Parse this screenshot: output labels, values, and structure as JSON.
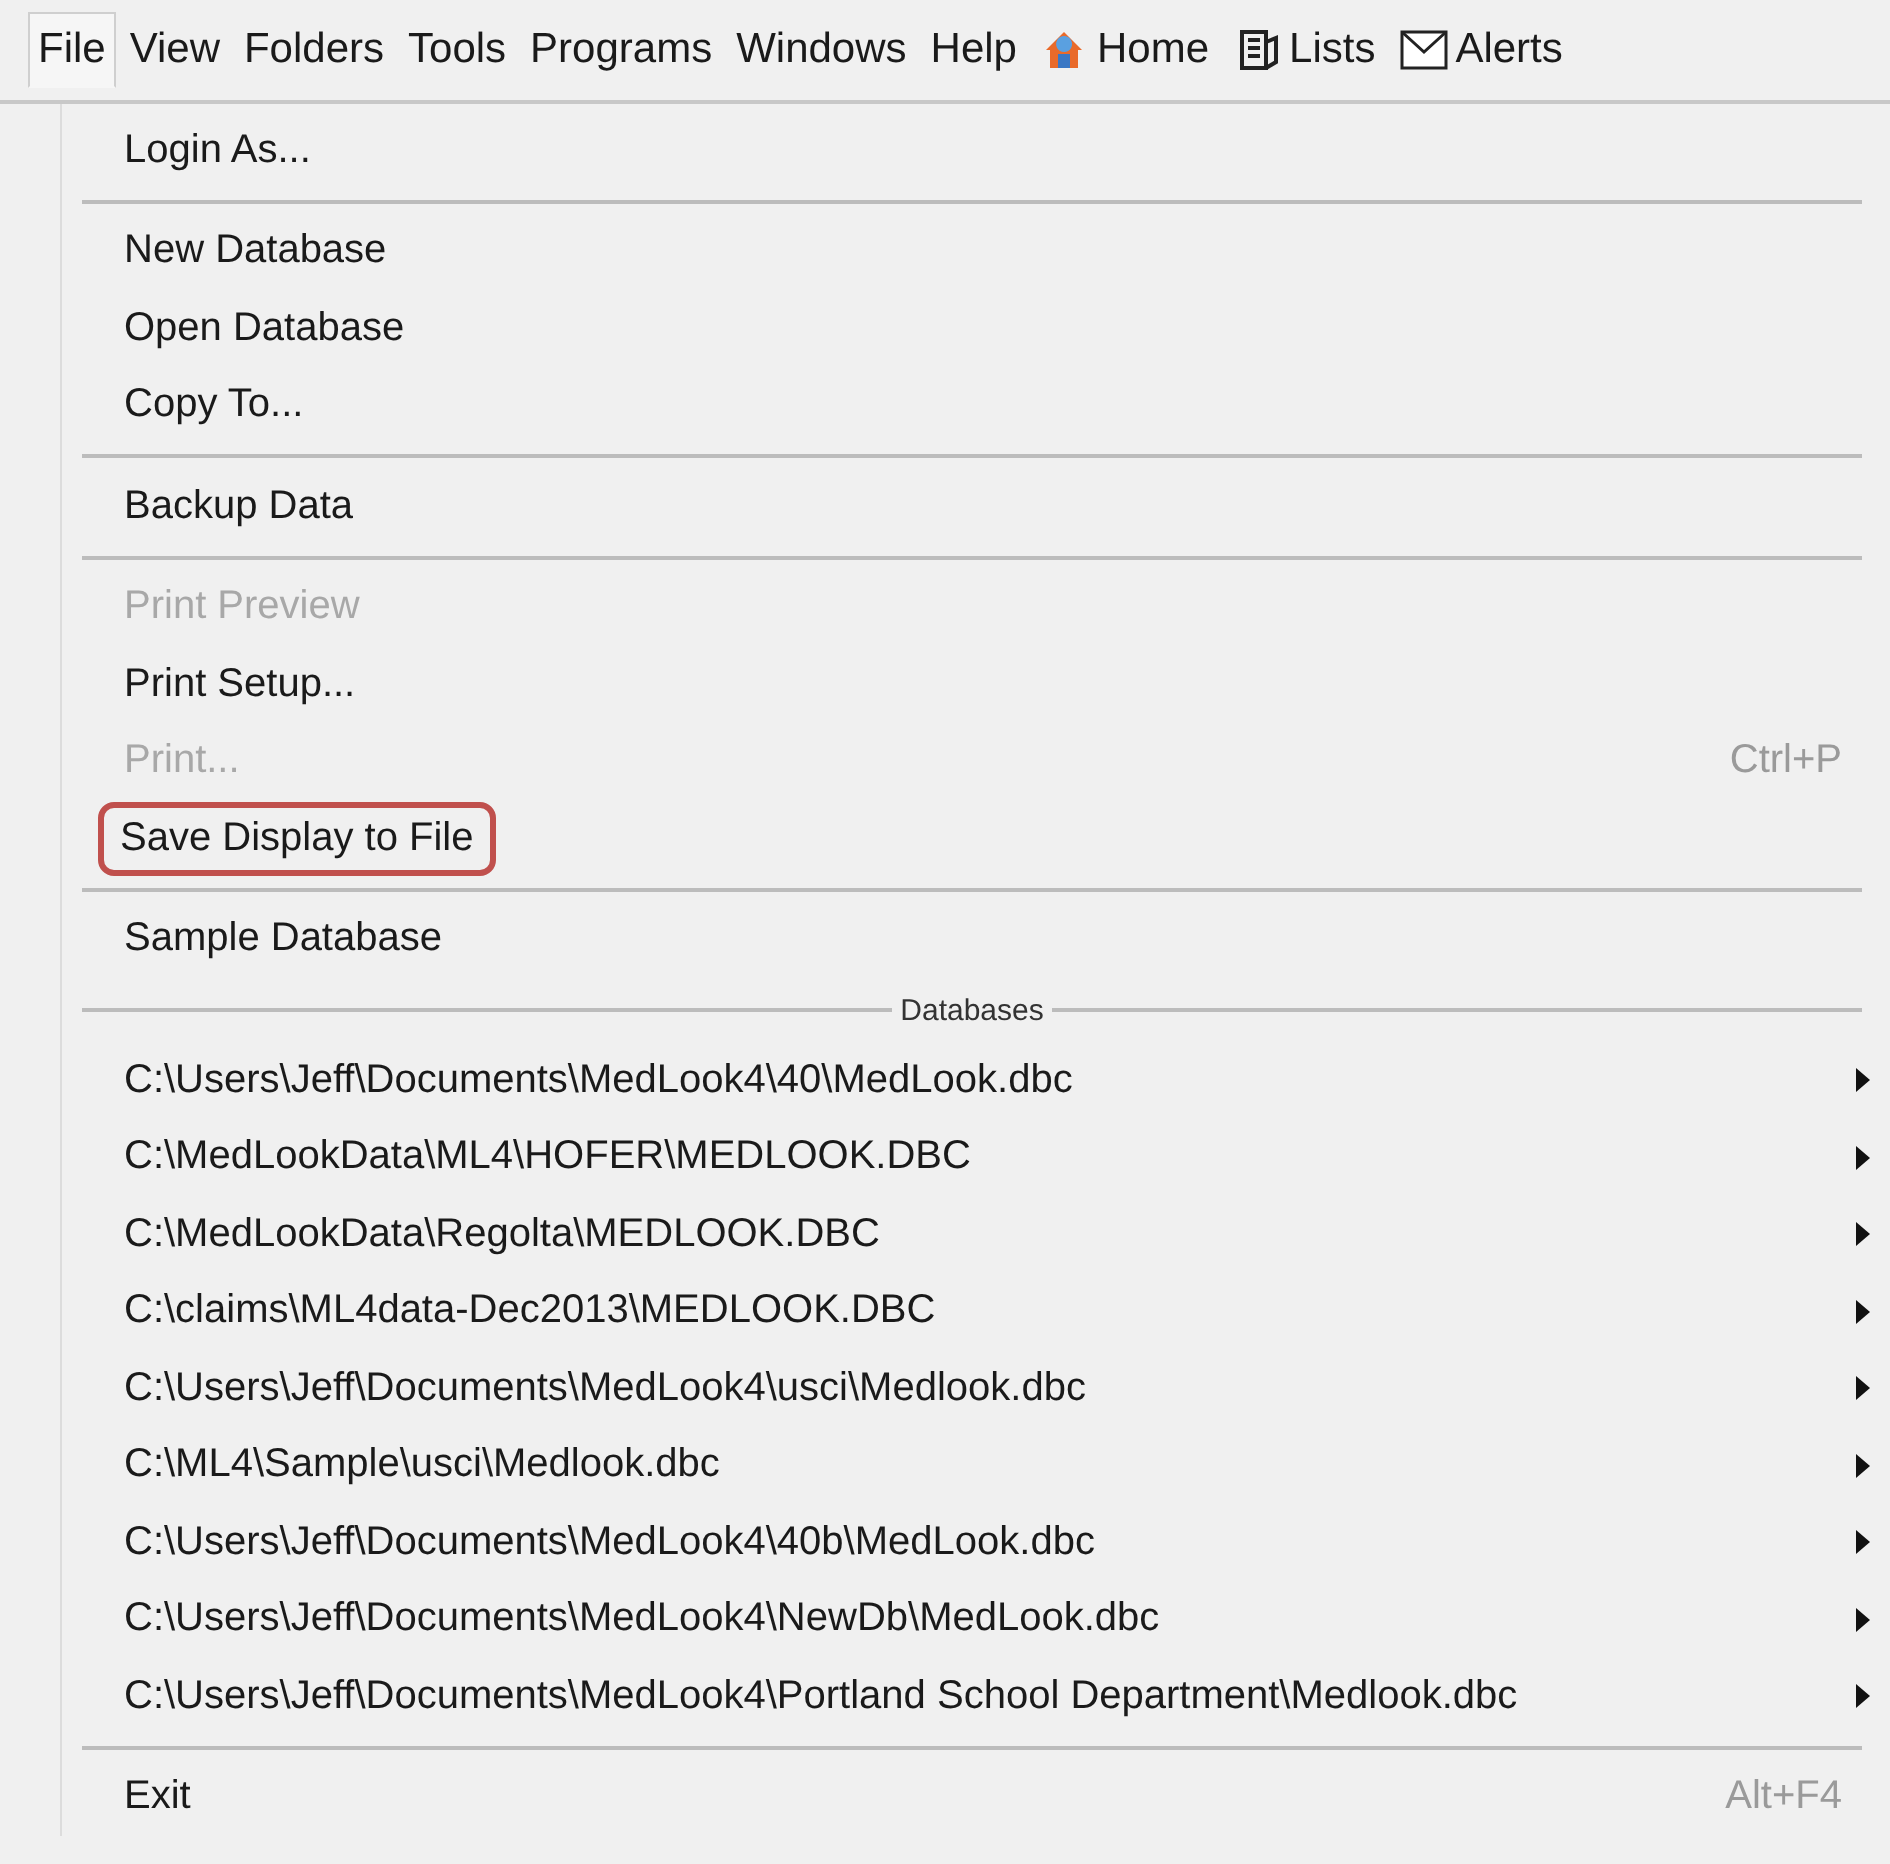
{
  "menubar": [
    {
      "label": "File",
      "selected": true,
      "kind": "text"
    },
    {
      "label": "View",
      "selected": false,
      "kind": "text"
    },
    {
      "label": "Folders",
      "selected": false,
      "kind": "text"
    },
    {
      "label": "Tools",
      "selected": false,
      "kind": "text"
    },
    {
      "label": "Programs",
      "selected": false,
      "kind": "text"
    },
    {
      "label": "Windows",
      "selected": false,
      "kind": "text"
    },
    {
      "label": "Help",
      "selected": false,
      "kind": "text"
    },
    {
      "label": "Home",
      "selected": false,
      "kind": "home"
    },
    {
      "label": "Lists",
      "selected": false,
      "kind": "lists"
    },
    {
      "label": "Alerts",
      "selected": false,
      "kind": "alerts"
    }
  ],
  "file_menu": [
    {
      "kind": "item",
      "label": "Login As...",
      "disabled": false,
      "highlighted": false
    },
    {
      "kind": "separator"
    },
    {
      "kind": "item",
      "label": "New Database",
      "disabled": false,
      "highlighted": false
    },
    {
      "kind": "item",
      "label": "Open Database",
      "disabled": false,
      "highlighted": false
    },
    {
      "kind": "item",
      "label": "Copy To...",
      "disabled": false,
      "highlighted": false
    },
    {
      "kind": "separator"
    },
    {
      "kind": "item",
      "label": "Backup Data",
      "disabled": false,
      "highlighted": false
    },
    {
      "kind": "separator"
    },
    {
      "kind": "item",
      "label": "Print Preview",
      "disabled": true,
      "highlighted": false
    },
    {
      "kind": "item",
      "label": "Print Setup...",
      "disabled": false,
      "highlighted": false
    },
    {
      "kind": "item",
      "label": "Print...",
      "disabled": true,
      "highlighted": false,
      "shortcut": "Ctrl+P"
    },
    {
      "kind": "item",
      "label": "Save Display to File",
      "disabled": false,
      "highlighted": true
    },
    {
      "kind": "separator"
    },
    {
      "kind": "item",
      "label": "Sample Database",
      "disabled": false,
      "highlighted": false
    },
    {
      "kind": "header",
      "label": "Databases"
    },
    {
      "kind": "submenu",
      "label": "C:\\Users\\Jeff\\Documents\\MedLook4\\40\\MedLook.dbc",
      "disabled": false,
      "highlighted": false
    },
    {
      "kind": "submenu",
      "label": "C:\\MedLookData\\ML4\\HOFER\\MEDLOOK.DBC",
      "disabled": false,
      "highlighted": false
    },
    {
      "kind": "submenu",
      "label": "C:\\MedLookData\\Regolta\\MEDLOOK.DBC",
      "disabled": false,
      "highlighted": false
    },
    {
      "kind": "submenu",
      "label": "C:\\claims\\ML4data-Dec2013\\MEDLOOK.DBC",
      "disabled": false,
      "highlighted": false
    },
    {
      "kind": "submenu",
      "label": "C:\\Users\\Jeff\\Documents\\MedLook4\\usci\\Medlook.dbc",
      "disabled": false,
      "highlighted": false
    },
    {
      "kind": "submenu",
      "label": "C:\\ML4\\Sample\\usci\\Medlook.dbc",
      "disabled": false,
      "highlighted": false
    },
    {
      "kind": "submenu",
      "label": "C:\\Users\\Jeff\\Documents\\MedLook4\\40b\\MedLook.dbc",
      "disabled": false,
      "highlighted": false
    },
    {
      "kind": "submenu",
      "label": "C:\\Users\\Jeff\\Documents\\MedLook4\\NewDb\\MedLook.dbc",
      "disabled": false,
      "highlighted": false
    },
    {
      "kind": "submenu",
      "label": "C:\\Users\\Jeff\\Documents\\MedLook4\\Portland School Department\\Medlook.dbc",
      "disabled": false,
      "highlighted": false
    },
    {
      "kind": "separator"
    },
    {
      "kind": "item",
      "label": "Exit",
      "disabled": false,
      "highlighted": false,
      "shortcut": "Alt+F4"
    }
  ]
}
